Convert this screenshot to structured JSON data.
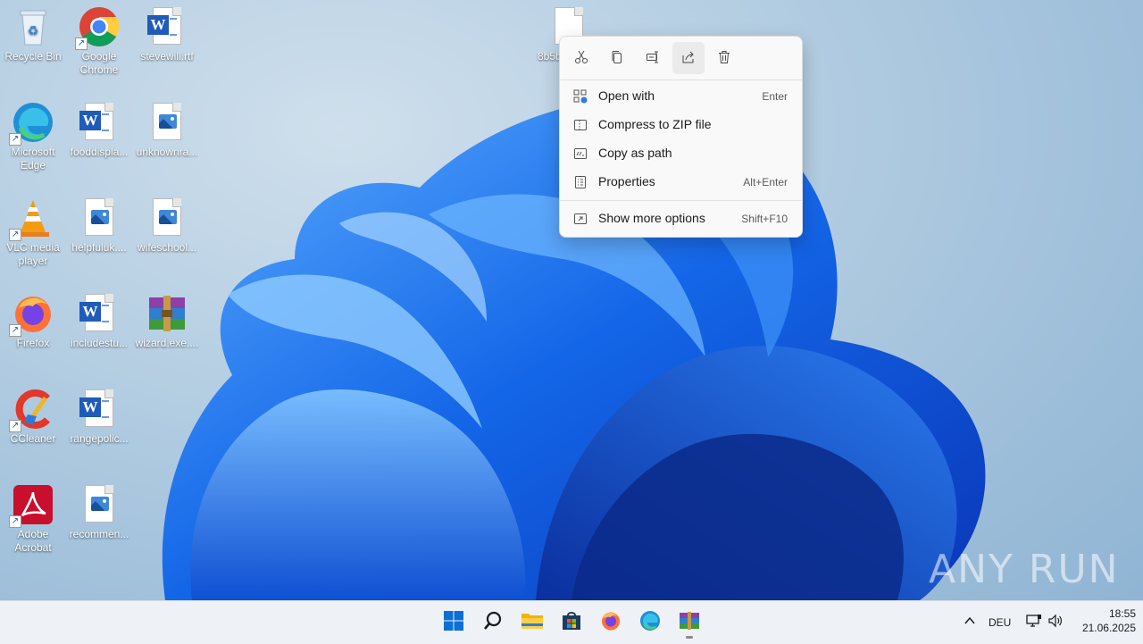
{
  "desktop": {
    "icons": [
      {
        "label": "Recycle Bin"
      },
      {
        "label": "Google Chrome"
      },
      {
        "label": "stevewill.rtf"
      },
      {
        "label": "Microsoft Edge"
      },
      {
        "label": "fooddispla..."
      },
      {
        "label": "unknownra..."
      },
      {
        "label": "VLC media player"
      },
      {
        "label": "helpfuluk...."
      },
      {
        "label": "wifeschool..."
      },
      {
        "label": "Firefox"
      },
      {
        "label": "includestu..."
      },
      {
        "label": "wizard.exe...."
      },
      {
        "label": "CCleaner"
      },
      {
        "label": "rangepolic..."
      },
      {
        "label": "Adobe Acrobat"
      },
      {
        "label": "recommen..."
      },
      {
        "label": "8b5b"
      }
    ]
  },
  "context_menu": {
    "toolbar": [
      {
        "name": "cut-icon"
      },
      {
        "name": "copy-icon"
      },
      {
        "name": "rename-icon"
      },
      {
        "name": "share-icon"
      },
      {
        "name": "delete-icon"
      }
    ],
    "items": [
      {
        "label": "Open with",
        "shortcut": "Enter"
      },
      {
        "label": "Compress to ZIP file",
        "shortcut": ""
      },
      {
        "label": "Copy as path",
        "shortcut": ""
      },
      {
        "label": "Properties",
        "shortcut": "Alt+Enter"
      },
      {
        "label": "Show more options",
        "shortcut": "Shift+F10"
      }
    ]
  },
  "taskbar": {
    "apps": [
      "start-icon",
      "search-icon",
      "file-explorer-icon",
      "store-icon",
      "firefox-icon",
      "edge-icon",
      "winrar-icon"
    ],
    "tray": {
      "language": "DEU",
      "time": "18:55",
      "date": "21.06.2025"
    }
  },
  "watermark": "ANY RUN",
  "colors": {
    "accent": "#0b6fd6",
    "word_blue": "#1f5bb8"
  }
}
